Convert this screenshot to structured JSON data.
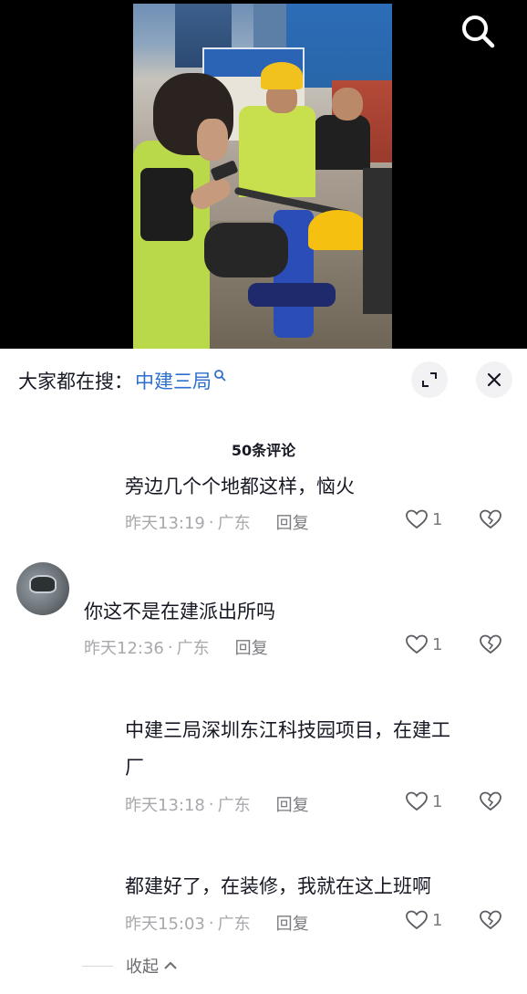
{
  "video": {
    "search_icon": "search-icon",
    "photo_description_icon": "construction-site-photo"
  },
  "sheet": {
    "search_prefix": "大家都在搜：",
    "search_term": "中建三局",
    "search_term_icon": "search-small-icon",
    "expand_icon": "expand-icon",
    "close_icon": "close-icon",
    "comment_count": "50条评论",
    "collapse_label": "收起"
  },
  "comments": [
    {
      "text": "旁边几个个地都这样，恼火",
      "time": "昨天13:19",
      "location": "广东",
      "reply_label": "回复",
      "likes": "1"
    },
    {
      "text": "你这不是在建派出所吗",
      "time": "昨天12:36",
      "location": "广东",
      "reply_label": "回复",
      "likes": "1",
      "avatar_icon": "car-mirror-avatar"
    },
    {
      "text_line1": "中建三局深圳东江科技园项目，在建工",
      "text_line2": "厂",
      "time": "昨天13:18",
      "location": "广东",
      "reply_label": "回复",
      "likes": "1"
    },
    {
      "text": "都建好了，在装修，我就在这上班啊",
      "time": "昨天15:03",
      "location": "广东",
      "reply_label": "回复",
      "likes": "1"
    }
  ],
  "separator": "·"
}
